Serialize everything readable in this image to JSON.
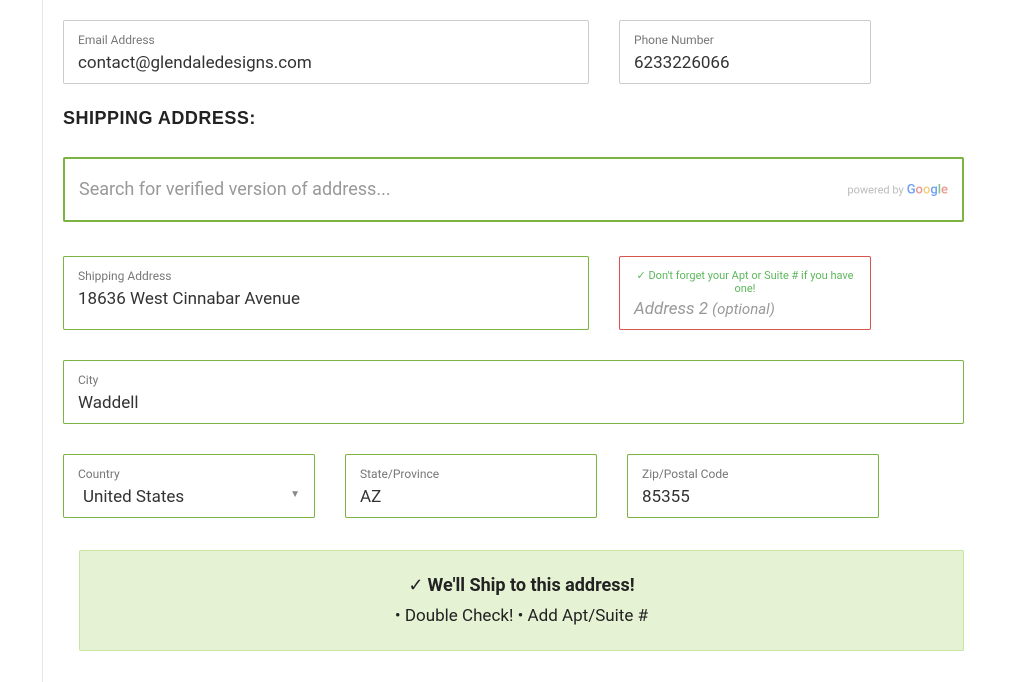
{
  "contact": {
    "email_label": "Email Address",
    "email_value": "contact@glendaledesigns.com",
    "phone_label": "Phone Number",
    "phone_value": "6233226066"
  },
  "section_title": "SHIPPING ADDRESS:",
  "search": {
    "placeholder": "Search for verified version of address...",
    "powered_by": "powered by"
  },
  "shipping": {
    "address_label": "Shipping Address",
    "address_value": "18636 West Cinnabar Avenue",
    "address2_hint": "✓ Don't forget your Apt or Suite # if you have one!",
    "address2_main": "Address 2",
    "address2_opt": "(optional)",
    "city_label": "City",
    "city_value": "Waddell",
    "country_label": "Country",
    "country_value": "United States",
    "state_label": "State/Province",
    "state_value": "AZ",
    "zip_label": "Zip/Postal Code",
    "zip_value": "85355"
  },
  "confirm": {
    "title": "We'll Ship to this address!",
    "sub": "• Double Check! • Add Apt/Suite #"
  }
}
